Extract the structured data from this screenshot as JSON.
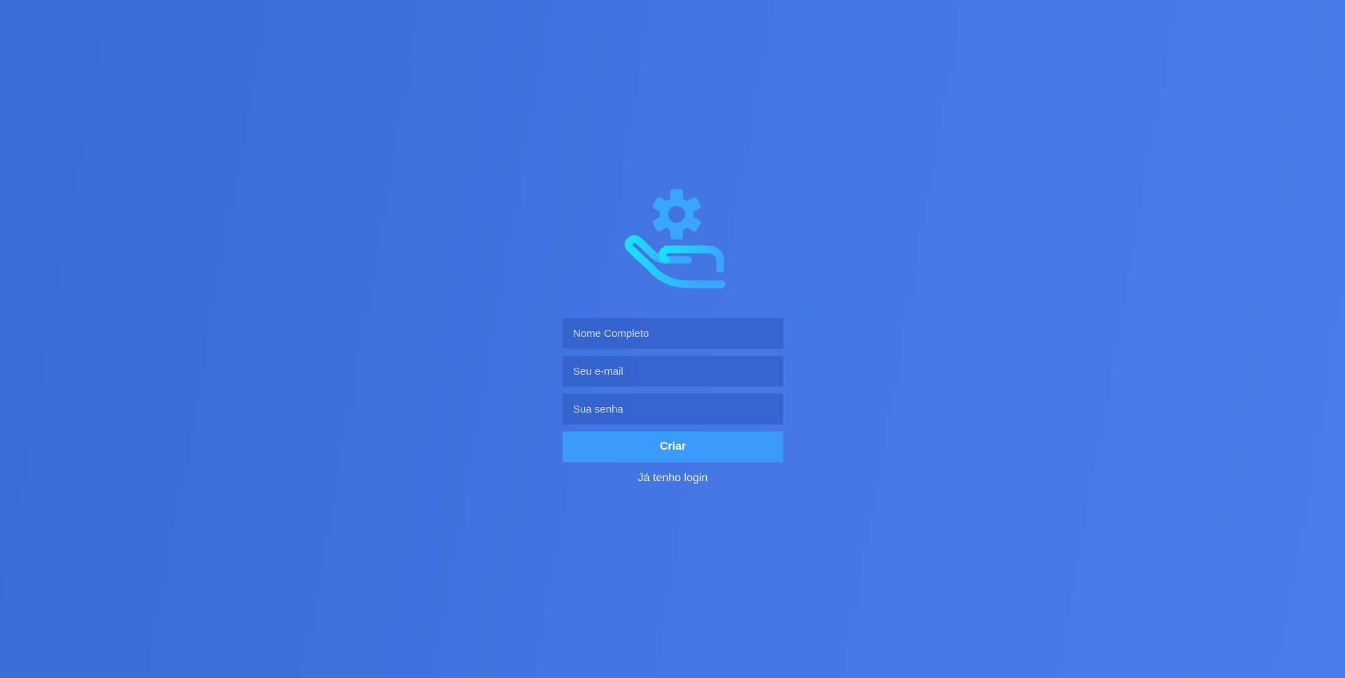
{
  "logo": {
    "icon": "hand-gear-icon",
    "gear_color": "#3aa6fb",
    "hand_gradient_start": "#16e4fa",
    "hand_gradient_end": "#3aa6fb"
  },
  "form": {
    "name_placeholder": "Nome Completo",
    "email_placeholder": "Seu e-mail",
    "password_placeholder": "Sua senha",
    "submit_label": "Criar",
    "login_link": "Já tenho login"
  },
  "colors": {
    "background": "#4274e0",
    "button": "#3b9bfa"
  }
}
